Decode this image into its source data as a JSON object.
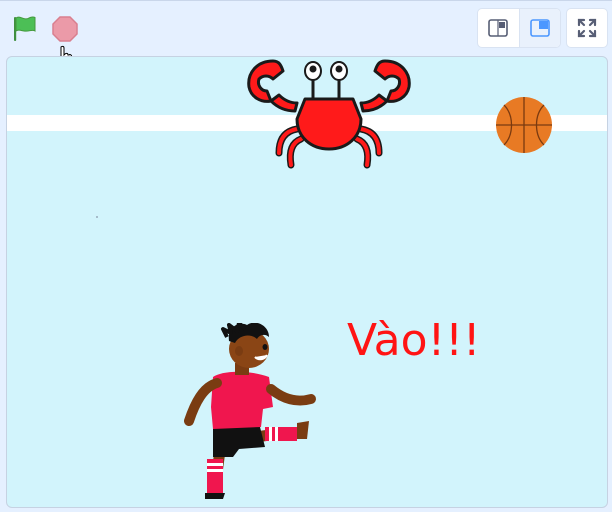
{
  "toolbar": {
    "green_flag": "green-flag-icon",
    "stop": "stop-icon",
    "layout_small": "small-stage-icon",
    "layout_normal": "normal-stage-icon",
    "fullscreen": "fullscreen-icon"
  },
  "stage": {
    "background_color": "#d2f4fc",
    "speech_text": "Vào!!!",
    "speech_color": "#ff1414",
    "sprites": [
      "crab",
      "basketball",
      "player"
    ]
  },
  "colors": {
    "flag": "#4cbf56",
    "stop": "#eb9aa8",
    "accent": "#4c97ff"
  }
}
